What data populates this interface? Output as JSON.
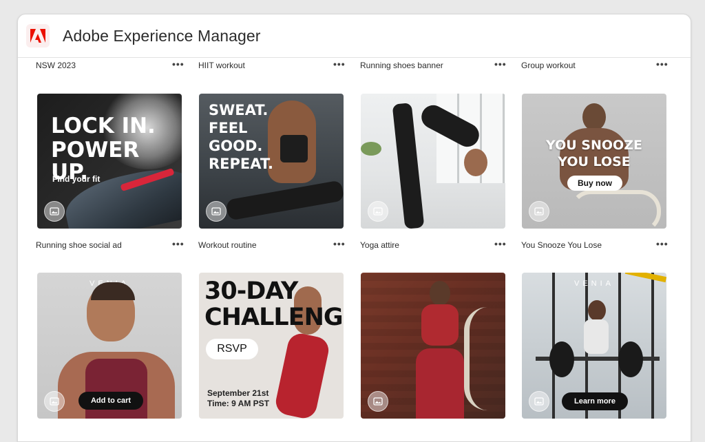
{
  "app": {
    "title": "Adobe Experience Manager"
  },
  "row1": [
    {
      "title": "NSW 2023"
    },
    {
      "title": "HIIT workout"
    },
    {
      "title": "Running shoes banner"
    },
    {
      "title": "Group workout"
    }
  ],
  "row2": [
    {
      "title": "Running shoe social ad"
    },
    {
      "title": "Workout routine"
    },
    {
      "title": "Yoga attire"
    },
    {
      "title": "You Snooze You Lose"
    }
  ],
  "more_label": "•••",
  "creatives": {
    "a": {
      "line1": "LOCK IN.",
      "line2": "POWER UP.",
      "cta": "Find your fit"
    },
    "b": {
      "line1": "SWEAT.",
      "line2": "FEEL",
      "line3": "GOOD.",
      "line4": "REPEAT."
    },
    "d": {
      "line1": "YOU SNOOZE",
      "line2": "YOU LOSE",
      "cta": "Buy now"
    },
    "e": {
      "brand": "VENIA",
      "cta": "Add to cart"
    },
    "f": {
      "line1": "30-DAY",
      "line2": "CHALLENGE",
      "cta": "RSVP",
      "date": "September 21st",
      "time": "Time: 9 AM PST"
    },
    "h": {
      "brand": "VENIA",
      "cta": "Learn more"
    }
  },
  "colors": {
    "accent": "#eb1000",
    "text": "#2c2c2c"
  },
  "icons": {
    "logo": "adobe-logo",
    "more": "more-icon",
    "asset": "image-icon"
  }
}
